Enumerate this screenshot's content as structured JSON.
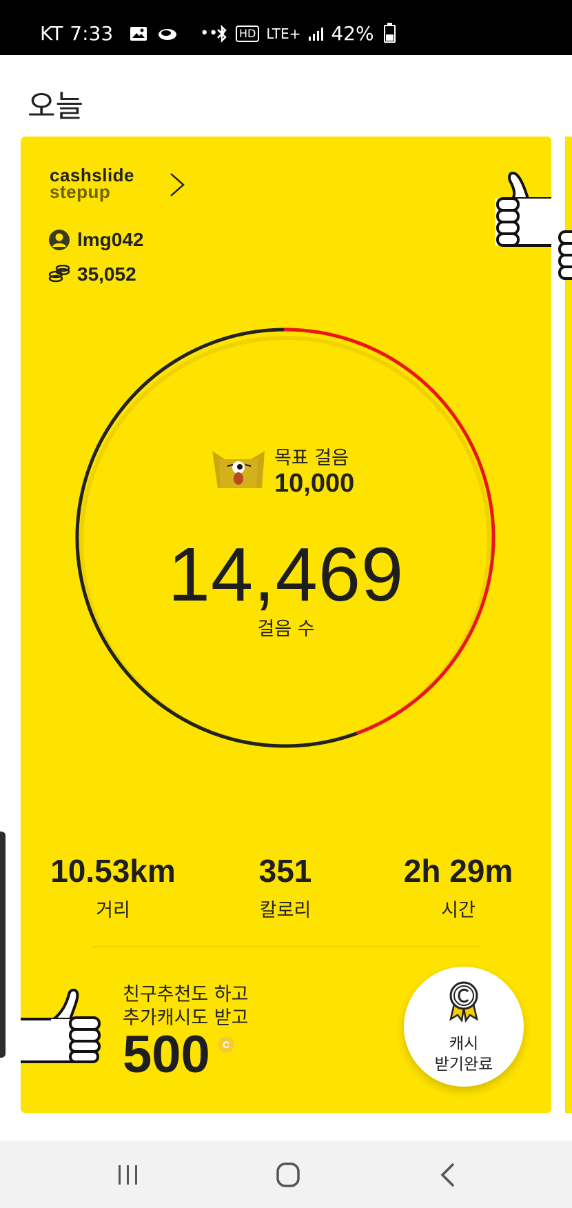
{
  "status_bar": {
    "carrier": "KT",
    "time": "7:33",
    "network": "LTE+",
    "battery": "42%",
    "hd_label": "HD"
  },
  "page": {
    "title": "오늘"
  },
  "card": {
    "brand_line1": "cashslide",
    "brand_line2": "stepup",
    "username": "lmg042",
    "coins": "35,052",
    "goal_label": "목표 걸음",
    "goal_value": "10,000",
    "steps_value": "14,469",
    "steps_label": "걸음 수",
    "steps_progress": 1.4469,
    "stats": [
      {
        "value": "10.53km",
        "label": "거리"
      },
      {
        "value": "351",
        "label": "칼로리"
      },
      {
        "value": "2h 29m",
        "label": "시간"
      }
    ],
    "promo_line1": "친구추천도 하고",
    "promo_line2": "추가캐시도 받고",
    "promo_amount": "500",
    "coin_symbol": "C",
    "cash_button_line1": "캐시",
    "cash_button_line2": "받기완료"
  },
  "colors": {
    "card_bg": "#ffe300",
    "progress_red": "#e8171b",
    "progress_dark": "#222222"
  },
  "icons": [
    "image-icon",
    "cloud-icon",
    "more-icon",
    "bluetooth-icon",
    "signal-icon",
    "user-icon",
    "coins-icon",
    "chevron-right-icon",
    "thumbs-up-icon",
    "mascot-icon",
    "medal-icon",
    "recent-apps-icon",
    "home-icon",
    "back-icon"
  ]
}
